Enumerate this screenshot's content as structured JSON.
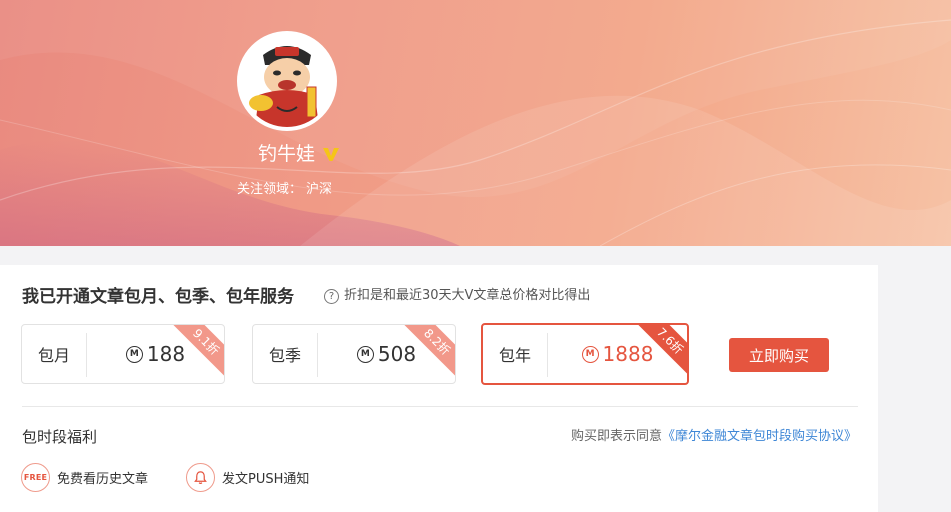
{
  "profile": {
    "username": "钓牛娃",
    "verified_icon": "v-verified-icon",
    "focus_label": "关注领域：",
    "focus_value": "沪深"
  },
  "subscription": {
    "title": "我已开通文章包月、包季、包年服务",
    "hint": "折扣是和最近30天大V文章总价格对比得出",
    "hint_icon": "question-circle-icon",
    "currency_icon": "m-coin-icon",
    "plans": [
      {
        "name": "包月",
        "price": "188",
        "discount": "9.1折",
        "selected": false
      },
      {
        "name": "包季",
        "price": "508",
        "discount": "8.2折",
        "selected": false
      },
      {
        "name": "包年",
        "price": "1888",
        "discount": "7.6折",
        "selected": true
      }
    ],
    "buy_label": "立即购买"
  },
  "benefits": {
    "title": "包时段福利",
    "agreement_prefix": "购买即表示同意",
    "agreement_link": "《摩尔金融文章包时段购买协议》",
    "items": [
      {
        "icon_text": "FREE",
        "label": "免费看历史文章"
      },
      {
        "icon": "bell-icon",
        "label": "发文PUSH通知"
      }
    ]
  },
  "colors": {
    "accent": "#e5553f",
    "link": "#3f87d6",
    "banner_start": "#e98a80",
    "banner_end": "#f6c2a5",
    "verified": "#f5c518"
  }
}
